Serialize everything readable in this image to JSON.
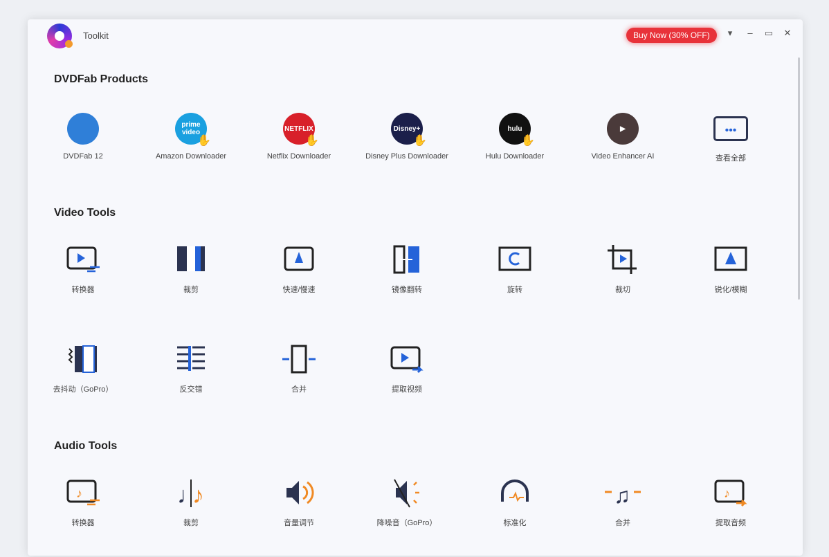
{
  "window": {
    "title": "Toolkit",
    "buy_now": "Buy Now (30% OFF)"
  },
  "colors": {
    "accent": "#2563d9",
    "audio_accent": "#f08a24",
    "buy": "#e8323a"
  },
  "sections": {
    "products": {
      "title": "DVDFab Products",
      "items": [
        {
          "label": "DVDFab 12",
          "icon": "dvdfab-icon",
          "color": "#2f7fd8",
          "text": ""
        },
        {
          "label": "Amazon Downloader",
          "icon": "prime-video-icon",
          "color": "#1aa0e0",
          "text": "prime video"
        },
        {
          "label": "Netflix Downloader",
          "icon": "netflix-icon",
          "color": "#d8202a",
          "text": "NETFLIX"
        },
        {
          "label": "Disney Plus Downloader",
          "icon": "disney-icon",
          "color": "#1b1f4a",
          "text": "Disney+"
        },
        {
          "label": "Hulu Downloader",
          "icon": "hulu-icon",
          "color": "#111",
          "text": "hulu"
        },
        {
          "label": "Video Enhancer AI",
          "icon": "enhancer-icon",
          "color": "#4a3a3a",
          "text": "▶"
        },
        {
          "label": "查看全部",
          "icon": "more-icon",
          "color": "",
          "text": "•••"
        }
      ]
    },
    "video": {
      "title": "Video Tools",
      "items": [
        {
          "label": "转换器",
          "icon": "video-convert-icon"
        },
        {
          "label": "裁剪",
          "icon": "video-trim-icon"
        },
        {
          "label": "快速/慢速",
          "icon": "speed-icon"
        },
        {
          "label": "镜像翻转",
          "icon": "mirror-icon"
        },
        {
          "label": "旋转",
          "icon": "rotate-icon"
        },
        {
          "label": "裁切",
          "icon": "crop-icon"
        },
        {
          "label": "锐化/模糊",
          "icon": "sharpen-icon"
        },
        {
          "label": "去抖动（GoPro）",
          "icon": "stabilize-icon"
        },
        {
          "label": "反交错",
          "icon": "deinterlace-icon"
        },
        {
          "label": "合并",
          "icon": "video-merge-icon"
        },
        {
          "label": "提取视频",
          "icon": "extract-video-icon"
        }
      ]
    },
    "audio": {
      "title": "Audio Tools",
      "items": [
        {
          "label": "转换器",
          "icon": "audio-convert-icon"
        },
        {
          "label": "裁剪",
          "icon": "audio-trim-icon"
        },
        {
          "label": "音量调节",
          "icon": "volume-icon"
        },
        {
          "label": "降噪音（GoPro）",
          "icon": "denoise-icon"
        },
        {
          "label": "标准化",
          "icon": "normalize-icon"
        },
        {
          "label": "合并",
          "icon": "audio-merge-icon"
        },
        {
          "label": "提取音频",
          "icon": "extract-audio-icon"
        }
      ]
    }
  }
}
